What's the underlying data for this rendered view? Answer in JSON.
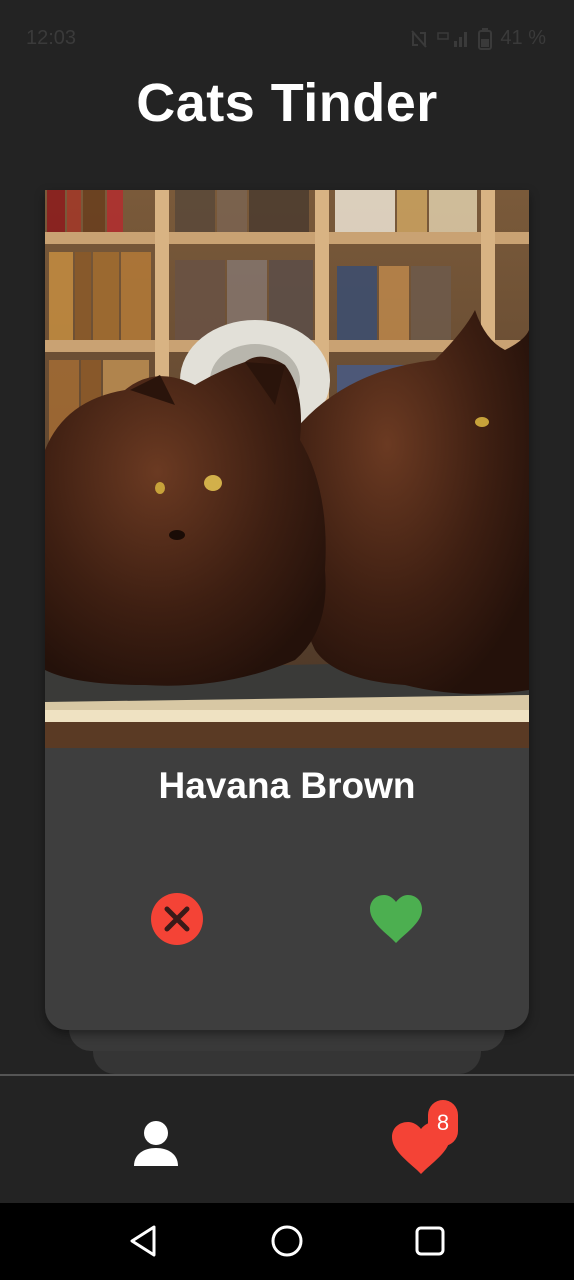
{
  "status_bar": {
    "time": "12:03",
    "battery_text": "41 %",
    "icons": [
      "nfc-off-icon",
      "signal-icon",
      "battery-icon"
    ]
  },
  "app": {
    "title": "Cats Tinder"
  },
  "card": {
    "image_alt": "Havana Brown cats",
    "name": "Havana Brown",
    "dislike_icon": "close-circle-icon",
    "like_icon": "heart-icon"
  },
  "bottom_nav": {
    "profile_icon": "person-icon",
    "likes_icon": "heart-icon",
    "likes_count": "8"
  },
  "system_nav": {
    "icons": [
      "back-icon",
      "home-icon",
      "recents-icon"
    ]
  },
  "colors": {
    "background": "#232323",
    "card": "#3e3e3e",
    "dislike": "#f44336",
    "like": "#4caf50",
    "badge": "#f44336"
  }
}
